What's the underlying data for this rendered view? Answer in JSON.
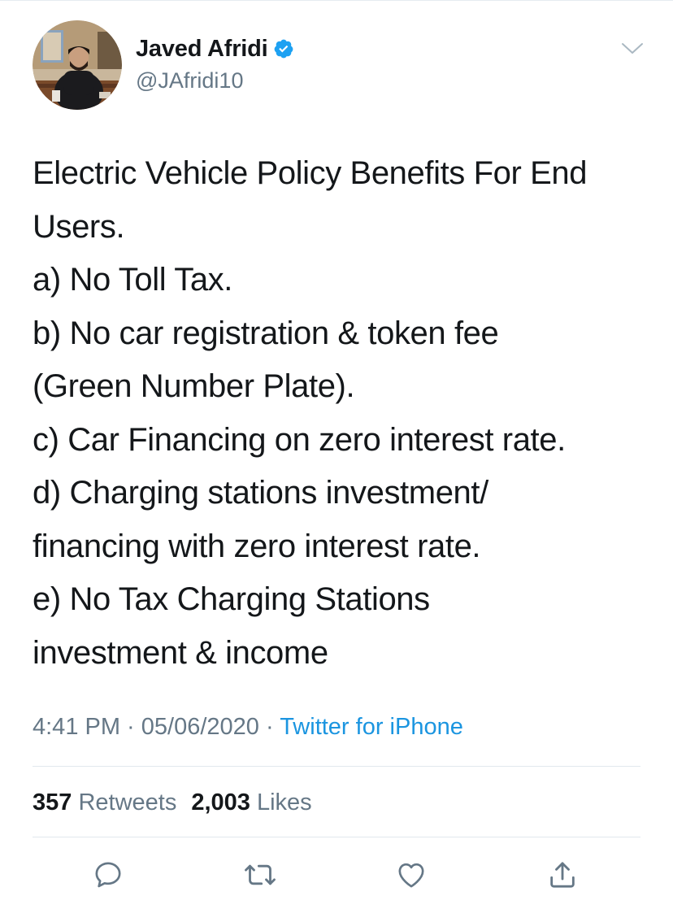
{
  "author": {
    "display_name": "Javed Afridi",
    "handle": "@JAfridi10",
    "verified": true
  },
  "tweet": {
    "lines": [
      "Electric Vehicle Policy Benefits For End",
      "Users.",
      "a) No Toll Tax.",
      "b) No car registration & token fee",
      "(Green Number Plate).",
      "c) Car Financing on zero interest rate.",
      "d) Charging stations investment/",
      "financing with zero interest rate.",
      "e) No Tax Charging Stations",
      "investment & income"
    ]
  },
  "meta": {
    "time": "4:41 PM",
    "separator": " · ",
    "date": "05/06/2020",
    "source": "Twitter for iPhone"
  },
  "stats": {
    "retweets_count": "357",
    "retweets_label": "Retweets",
    "likes_count": "2,003",
    "likes_label": "Likes"
  },
  "icons": {
    "verified": "verified-badge-icon",
    "menu": "chevron-down-icon",
    "reply": "reply-icon",
    "retweet": "retweet-icon",
    "like": "heart-icon",
    "share": "share-icon"
  },
  "colors": {
    "text": "#14171a",
    "secondary": "#657786",
    "link": "#1b95e0",
    "verified": "#1da1f2",
    "divider": "#e1e8ed",
    "action_icon": "#657786"
  }
}
